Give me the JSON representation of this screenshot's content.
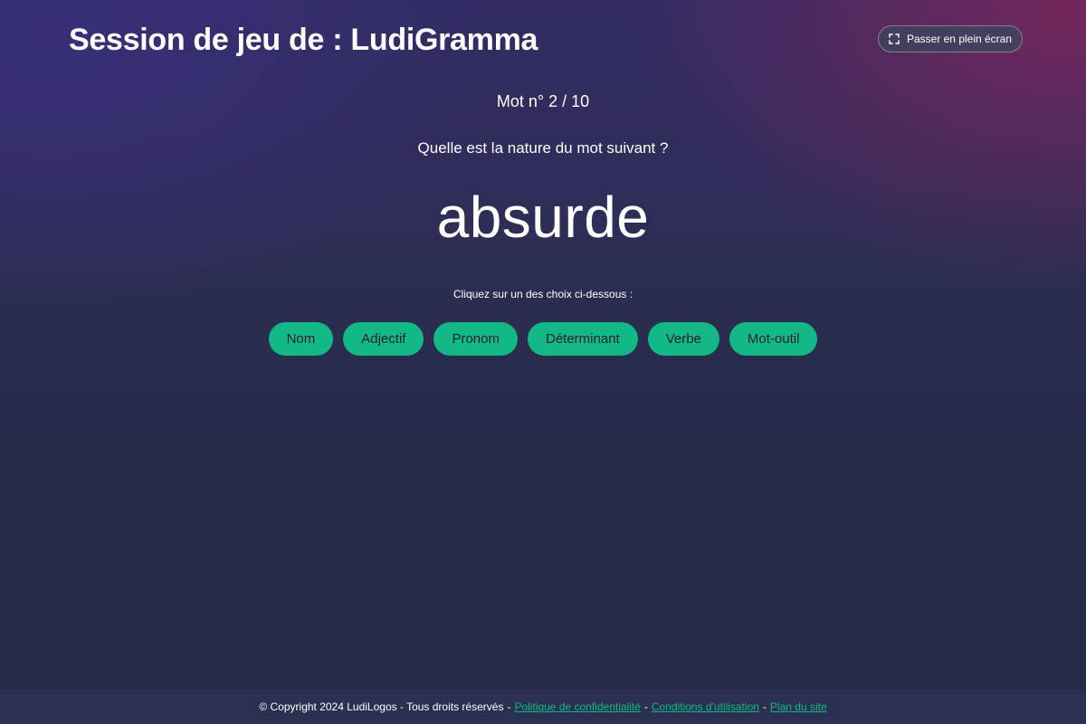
{
  "header": {
    "title": "Session de jeu de : LudiGramma",
    "fullscreen_label": "Passer en plein écran",
    "fullscreen_icon": "expand-icon"
  },
  "game": {
    "counter": "Mot n° 2 / 10",
    "question": "Quelle est la nature du mot suivant ?",
    "word": "absurde",
    "instruction": "Cliquez sur un des choix ci-dessous :",
    "choices": [
      "Nom",
      "Adjectif",
      "Pronom",
      "Déterminant",
      "Verbe",
      "Mot-outil"
    ]
  },
  "footer": {
    "copyright": "© Copyright 2024 LudiLogos - Tous droits réservés",
    "separator": "-",
    "links": [
      "Politique de confidentialité",
      "Conditions d'utilisation",
      "Plan du site"
    ]
  },
  "colors": {
    "accent": "#12b886",
    "background": "#262c48",
    "footer_background": "#2a3150"
  }
}
